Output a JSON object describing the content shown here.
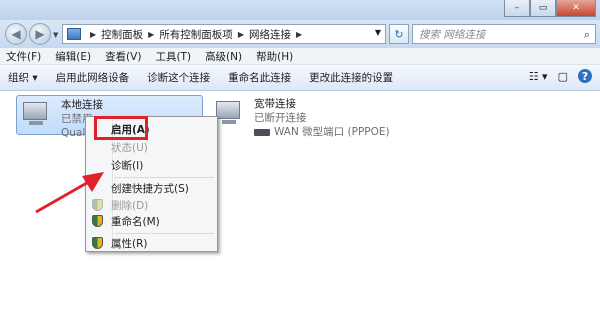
{
  "window": {
    "controls": [
      "–",
      "▭",
      "✕"
    ]
  },
  "address": {
    "breadcrumbs": [
      "控制面板",
      "所有控制面板项",
      "网络连接"
    ],
    "search_placeholder": "搜索 网络连接"
  },
  "menu": [
    "文件(F)",
    "编辑(E)",
    "查看(V)",
    "工具(T)",
    "高级(N)",
    "帮助(H)"
  ],
  "toolbar": [
    "组织 ▾",
    "启用此网络设备",
    "诊断这个连接",
    "重命名此连接",
    "更改此连接的设置"
  ],
  "connections": [
    {
      "name": "本地连接",
      "status": "已禁用",
      "device": "Qualc"
    },
    {
      "name": "宽带连接",
      "status": "已断开连接",
      "device": "WAN 微型端口 (PPPOE)"
    }
  ],
  "context_menu": {
    "items": [
      {
        "label": "启用(A)",
        "state": "default"
      },
      {
        "label": "状态(U)",
        "state": "disabled"
      },
      {
        "label": "诊断(I)",
        "state": "normal"
      },
      {
        "label": "创建快捷方式(S)",
        "state": "normal"
      },
      {
        "label": "删除(D)",
        "state": "disabled"
      },
      {
        "label": "重命名(M)",
        "state": "normal"
      },
      {
        "label": "属性(R)",
        "state": "normal"
      }
    ]
  },
  "colors": {
    "highlight_box": "#e0202a",
    "arrow": "#e0202a",
    "selection": "#c1dcfc"
  }
}
